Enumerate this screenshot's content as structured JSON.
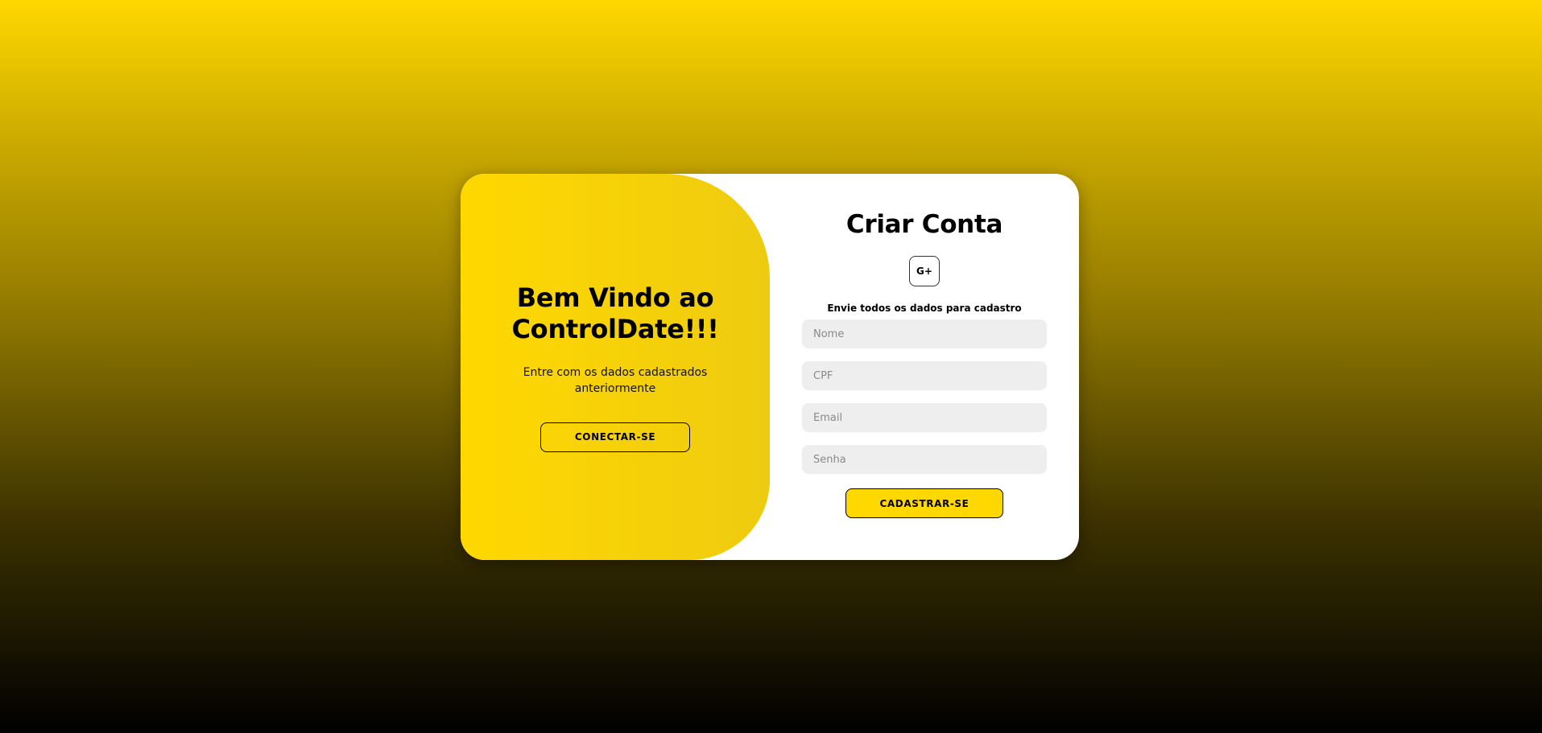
{
  "welcome": {
    "title": "Bem Vindo ao ControlDate!!!",
    "text": "Entre com os dados cadastrados anteriormente",
    "button_label": "CONECTAR-SE"
  },
  "signup": {
    "title": "Criar Conta",
    "social_label": "G+",
    "social_icon": "google-plus-icon",
    "subtitle": "Envie todos os dados para cadastro",
    "fields": {
      "name_placeholder": "Nome",
      "cpf_placeholder": "CPF",
      "email_placeholder": "Email",
      "password_placeholder": "Senha"
    },
    "submit_label": "CADASTRAR-SE"
  },
  "colors": {
    "accent": "#ffd800",
    "background_top": "#ffd800",
    "background_bottom": "#000000",
    "card": "#ffffff",
    "input_bg": "#eeeeee"
  }
}
